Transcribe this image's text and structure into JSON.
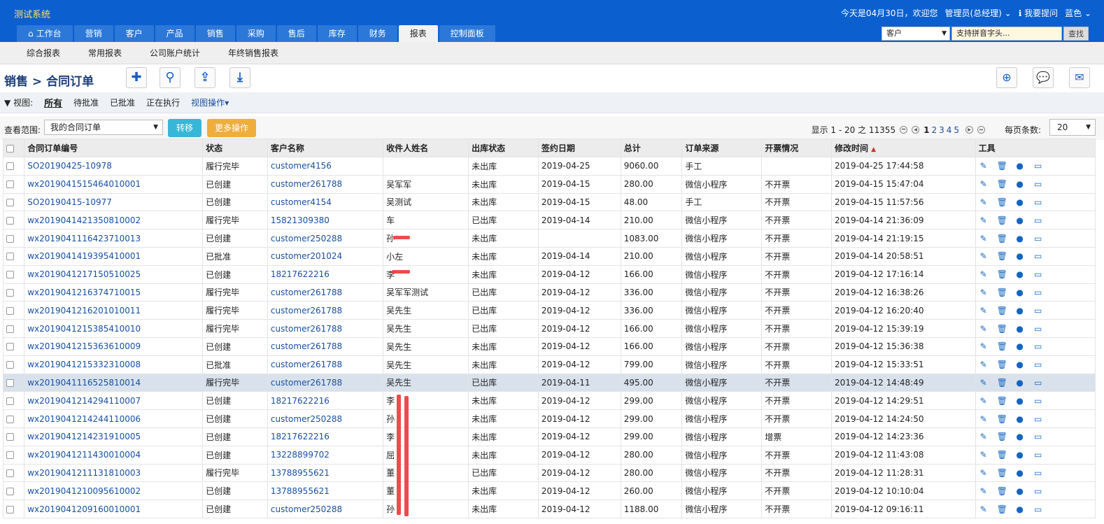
{
  "app": {
    "title": "测试系统"
  },
  "topbar": {
    "date_greeting": "今天是04月30日，欢迎您",
    "user": "管理员(总经理)",
    "help": "我要提问",
    "theme": "蓝色"
  },
  "nav": {
    "tabs": [
      "工作台",
      "营销",
      "客户",
      "产品",
      "销售",
      "采购",
      "售后",
      "库存",
      "财务",
      "报表",
      "控制面板"
    ],
    "active_index": 9
  },
  "search": {
    "scope": "客户",
    "placeholder": "支持拼音字头...",
    "button": "查找"
  },
  "subnav": {
    "items": [
      "综合报表",
      "常用报表",
      "公司账户统计",
      "年终销售报表"
    ]
  },
  "breadcrumb": "销售 > 合同订单",
  "viewbar": {
    "label": "视图:",
    "views": [
      "所有",
      "待批准",
      "已批准",
      "正在执行"
    ],
    "op": "视图操作"
  },
  "filter": {
    "scope_label": "查看范围:",
    "scope_value": "我的合同订单",
    "move_button": "转移",
    "more_button": "更多操作",
    "showing": "显示 1 - 20 之 11355",
    "pages": [
      "1",
      "2",
      "3",
      "4",
      "5"
    ],
    "current_page": "1",
    "page_size_label": "每页条数:",
    "page_size": "20"
  },
  "colors": {
    "topbar": "#0b5fcf",
    "link": "#1a4fa0",
    "highlight_row": "#d9e2ec",
    "move_btn": "#38b6d8",
    "more_btn": "#efad3c"
  },
  "table": {
    "headers": [
      "合同订单编号",
      "状态",
      "客户名称",
      "收件人姓名",
      "出库状态",
      "签约日期",
      "总计",
      "订单来源",
      "开票情况",
      "修改时间",
      "工具"
    ],
    "rows": [
      [
        "SO20190425-10978",
        "履行完毕",
        "customer4156",
        "",
        "未出库",
        "2019-04-25",
        "9060.00",
        "手工",
        "",
        "2019-04-25 17:44:58"
      ],
      [
        "wx2019041515464010001",
        "已创建",
        "customer261788",
        "吴军军",
        "未出库",
        "2019-04-15",
        "280.00",
        "微信小程序",
        "不开票",
        "2019-04-15 15:47:04"
      ],
      [
        "SO20190415-10977",
        "已创建",
        "customer4154",
        "吴测试",
        "未出库",
        "2019-04-15",
        "48.00",
        "手工",
        "不开票",
        "2019-04-15 11:57:56"
      ],
      [
        "wx2019041421350810002",
        "履行完毕",
        "15821309380",
        "车",
        "已出库",
        "2019-04-14",
        "210.00",
        "微信小程序",
        "不开票",
        "2019-04-14 21:36:09"
      ],
      [
        "wx2019041116423710013",
        "已创建",
        "customer250288",
        "孙",
        "未出库",
        "",
        "1083.00",
        "微信小程序",
        "不开票",
        "2019-04-14 21:19:15"
      ],
      [
        "wx2019041419395410001",
        "已批准",
        "customer201024",
        "小左",
        "未出库",
        "2019-04-14",
        "210.00",
        "微信小程序",
        "不开票",
        "2019-04-14 20:58:51"
      ],
      [
        "wx2019041217150510025",
        "已创建",
        "18217622216",
        "李",
        "未出库",
        "2019-04-12",
        "166.00",
        "微信小程序",
        "不开票",
        "2019-04-12 17:16:14"
      ],
      [
        "wx2019041216374710015",
        "履行完毕",
        "customer261788",
        "吴军军测试",
        "已出库",
        "2019-04-12",
        "336.00",
        "微信小程序",
        "不开票",
        "2019-04-12 16:38:26"
      ],
      [
        "wx2019041216201010011",
        "履行完毕",
        "customer261788",
        "吴先生",
        "已出库",
        "2019-04-12",
        "336.00",
        "微信小程序",
        "不开票",
        "2019-04-12 16:20:40"
      ],
      [
        "wx2019041215385410010",
        "履行完毕",
        "customer261788",
        "吴先生",
        "已出库",
        "2019-04-12",
        "166.00",
        "微信小程序",
        "不开票",
        "2019-04-12 15:39:19"
      ],
      [
        "wx2019041215363610009",
        "已创建",
        "customer261788",
        "吴先生",
        "未出库",
        "2019-04-12",
        "166.00",
        "微信小程序",
        "不开票",
        "2019-04-12 15:36:38"
      ],
      [
        "wx2019041215332310008",
        "已批准",
        "customer261788",
        "吴先生",
        "未出库",
        "2019-04-12",
        "799.00",
        "微信小程序",
        "不开票",
        "2019-04-12 15:33:51"
      ],
      [
        "wx2019041116525810014",
        "履行完毕",
        "customer261788",
        "吴先生",
        "已出库",
        "2019-04-11",
        "495.00",
        "微信小程序",
        "不开票",
        "2019-04-12 14:48:49"
      ],
      [
        "wx2019041214294110007",
        "已创建",
        "18217622216",
        "李",
        "未出库",
        "2019-04-12",
        "299.00",
        "微信小程序",
        "不开票",
        "2019-04-12 14:29:51"
      ],
      [
        "wx2019041214244110006",
        "已创建",
        "customer250288",
        "孙",
        "未出库",
        "2019-04-12",
        "299.00",
        "微信小程序",
        "不开票",
        "2019-04-12 14:24:50"
      ],
      [
        "wx2019041214231910005",
        "已创建",
        "18217622216",
        "李",
        "未出库",
        "2019-04-12",
        "299.00",
        "微信小程序",
        "增票",
        "2019-04-12 14:23:36"
      ],
      [
        "wx2019041211430010004",
        "已创建",
        "13228899702",
        "屈",
        "未出库",
        "2019-04-12",
        "280.00",
        "微信小程序",
        "不开票",
        "2019-04-12 11:43:08"
      ],
      [
        "wx2019041211131810003",
        "履行完毕",
        "13788955621",
        "董",
        "已出库",
        "2019-04-12",
        "280.00",
        "微信小程序",
        "不开票",
        "2019-04-12 11:28:31"
      ],
      [
        "wx2019041210095610002",
        "已创建",
        "13788955621",
        "董",
        "未出库",
        "2019-04-12",
        "260.00",
        "微信小程序",
        "不开票",
        "2019-04-12 10:10:04"
      ],
      [
        "wx2019041209160010001",
        "已创建",
        "customer250288",
        "孙",
        "未出库",
        "2019-04-12",
        "1188.00",
        "微信小程序",
        "不开票",
        "2019-04-12 09:16:11"
      ]
    ],
    "highlight_row": 12,
    "sorted_column": 9
  },
  "icons": {
    "home": "home-icon",
    "add": "plus-icon",
    "search": "search-icon",
    "upload": "upload-icon",
    "download": "download-icon",
    "new": "circle-plus-icon",
    "chat": "chat-icon",
    "mail": "mail-icon",
    "edit": "edit-icon",
    "delete": "trash-icon",
    "comment": "comment-icon",
    "monitor": "monitor-icon"
  }
}
